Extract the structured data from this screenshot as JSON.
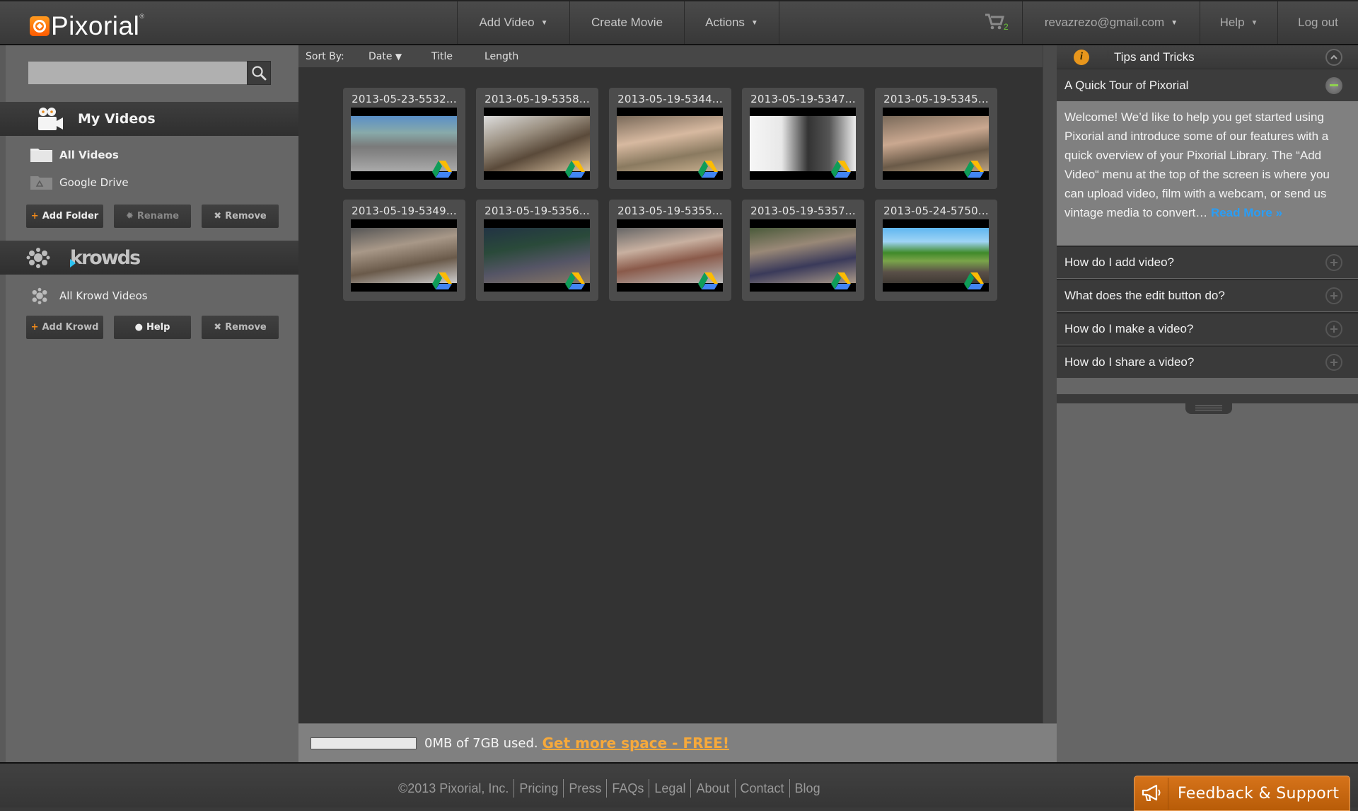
{
  "header": {
    "logo": "Pixorial",
    "nav": [
      {
        "label": "Add Video",
        "has_caret": true
      },
      {
        "label": "Create Movie",
        "has_caret": false
      },
      {
        "label": "Actions",
        "has_caret": true
      }
    ],
    "cart_count": "2",
    "user_email": "revazrezo@gmail.com",
    "help_label": "Help",
    "logout_label": "Log out"
  },
  "sidebar": {
    "search": {
      "value": "",
      "placeholder": ""
    },
    "my_videos": {
      "title": "My Videos",
      "folders": [
        {
          "label": "All Videos",
          "icon": "folder-icon",
          "selected": true
        },
        {
          "label": "Google Drive",
          "icon": "google-drive-folder-icon",
          "selected": false
        }
      ],
      "buttons": {
        "add": "Add Folder",
        "rename": "Rename",
        "remove": "Remove"
      }
    },
    "krowds": {
      "title": "krowds",
      "items": [
        {
          "label": "All Krowd Videos",
          "icon": "krowd-icon"
        }
      ],
      "buttons": {
        "add": "Add Krowd",
        "help": "Help",
        "remove": "Remove"
      }
    }
  },
  "sort": {
    "label": "Sort By:",
    "options": [
      "Date",
      "Title",
      "Length"
    ],
    "active": "Date"
  },
  "videos": [
    {
      "title": "2013-05-23-5532...",
      "source": "google-drive"
    },
    {
      "title": "2013-05-19-5358...",
      "source": "google-drive"
    },
    {
      "title": "2013-05-19-5344...",
      "source": "google-drive"
    },
    {
      "title": "2013-05-19-5347...",
      "source": "google-drive"
    },
    {
      "title": "2013-05-19-5345...",
      "source": "google-drive"
    },
    {
      "title": "2013-05-19-5349...",
      "source": "google-drive"
    },
    {
      "title": "2013-05-19-5356...",
      "source": "google-drive"
    },
    {
      "title": "2013-05-19-5355...",
      "source": "google-drive"
    },
    {
      "title": "2013-05-19-5357...",
      "source": "google-drive"
    },
    {
      "title": "2013-05-24-5750...",
      "source": "google-drive"
    }
  ],
  "storage": {
    "used_fraction": 0,
    "text": "0MB of 7GB used.",
    "link": "Get more space - FREE!",
    "link_color": "#f6a93b"
  },
  "tips": {
    "title": "Tips and Tricks",
    "tour": {
      "title": "A Quick Tour of Pixorial",
      "body": "Welcome! We’d like to help you get started using Pixorial and introduce some of our features with a quick overview of your Pixorial Library. The “Add Video“ menu at the top of the screen is where you can upload video, film with a webcam, or send us vintage media to convert… ",
      "read_more": "Read More »"
    },
    "faqs": [
      "How do I add video?",
      "What does the edit button do?",
      "How do I make a video?",
      "How do I share a video?"
    ]
  },
  "footer": {
    "copyright": "©2013 Pixorial, Inc.",
    "links": [
      "Pricing",
      "Press",
      "FAQs",
      "Legal",
      "About",
      "Contact",
      "Blog"
    ],
    "feedback": "Feedback & Support"
  },
  "colors": {
    "accent_orange": "#ff7a00",
    "link_blue": "#2a9df4",
    "cart_green": "#6bc43a"
  }
}
